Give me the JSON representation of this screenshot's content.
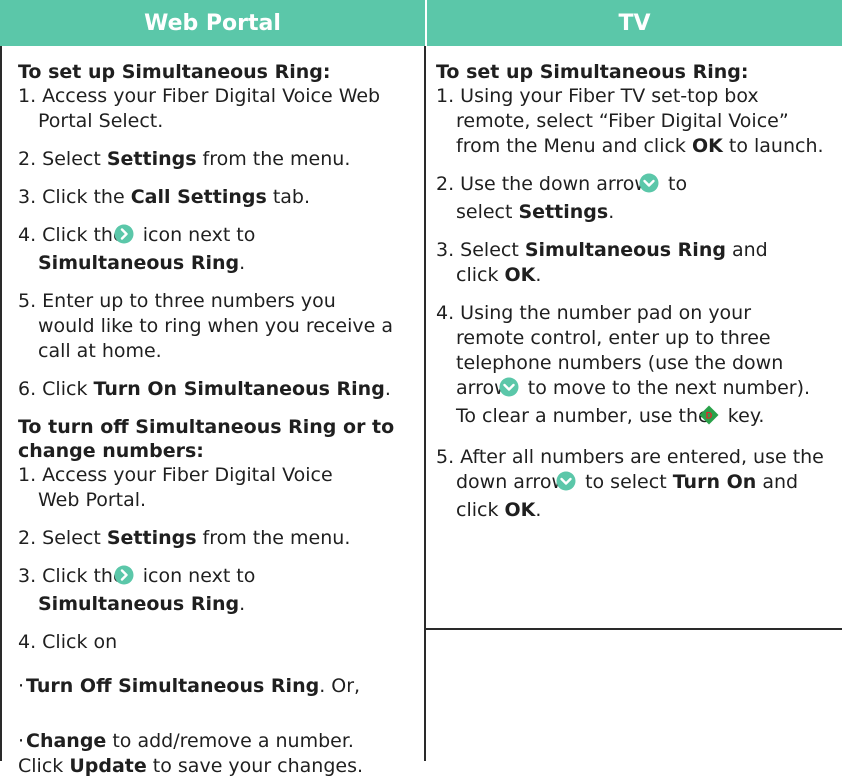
{
  "headers": {
    "left": "Web Portal",
    "right": "TV"
  },
  "left": {
    "title1": "To set up Simultaneous Ring:",
    "s1": "1. Access your Fiber Digital Voice Web Portal Select.",
    "s2a": "2. Select ",
    "s2b": "Settings",
    "s2c": " from the menu.",
    "s3a": "3. Click the ",
    "s3b": "Call Settings",
    "s3c": " tab.",
    "s4a": "4. Click the ",
    "s4b": " icon next to ",
    "s4c": "Simultaneous Ring",
    "s4d": ".",
    "s5": "5. Enter up to three numbers you would like to ring when you receive a call at home.",
    "s6a": "6. Click ",
    "s6b": "Turn On Simultaneous Ring",
    "s6c": ".",
    "title2": "To turn off Simultaneous Ring or to change numbers:",
    "t1": "1. Access your Fiber Digital Voice Web Portal.",
    "t2a": "2. Select ",
    "t2b": "Settings",
    "t2c": " from the menu.",
    "t3a": "3. Click the ",
    "t3b": " icon next to ",
    "t3c": "Simultaneous Ring",
    "t3d": ".",
    "t4": "4. Click on",
    "b1a": "Turn Off Simultaneous Ring",
    "b1b": ". Or,",
    "b2a": "Change",
    "b2b": " to add/remove a number.",
    "b2c": "Click ",
    "b2d": "Update",
    "b2e": " to save your changes."
  },
  "right": {
    "title1": "To set up Simultaneous Ring:",
    "r1a": "1. Using your Fiber TV set-top box remote, select “Fiber Digital Voice” from the Menu and click ",
    "r1b": "OK",
    "r1c": " to launch.",
    "r2a": "2. Use the down arrow ",
    "r2b": " to select ",
    "r2c": "Settings",
    "r2d": ".",
    "r3a": "3. Select ",
    "r3b": "Simultaneous Ring",
    "r3c": " and click ",
    "r3d": "OK",
    "r3e": ".",
    "r4a": "4. Using the number pad on your remote control, enter up to three telephone numbers (use the down arrow ",
    "r4b": " to move to the next number). To clear a number, use the ",
    "r4c": " key.",
    "r5a": "5. After all numbers are entered, use the down arrow ",
    "r5b": " to select ",
    "r5c": "Turn On",
    "r5d": " and click ",
    "r5e": "OK",
    "r5f": "."
  },
  "icons": {
    "arrow_right": "chevron-right-circle-icon",
    "arrow_down": "chevron-down-circle-icon",
    "d_key": "d-key-diamond-icon",
    "d_key_label": "D",
    "icon_color": "#5bc7a9",
    "d_key_color": "#2aa14a",
    "d_key_text_color": "#e8232a"
  }
}
